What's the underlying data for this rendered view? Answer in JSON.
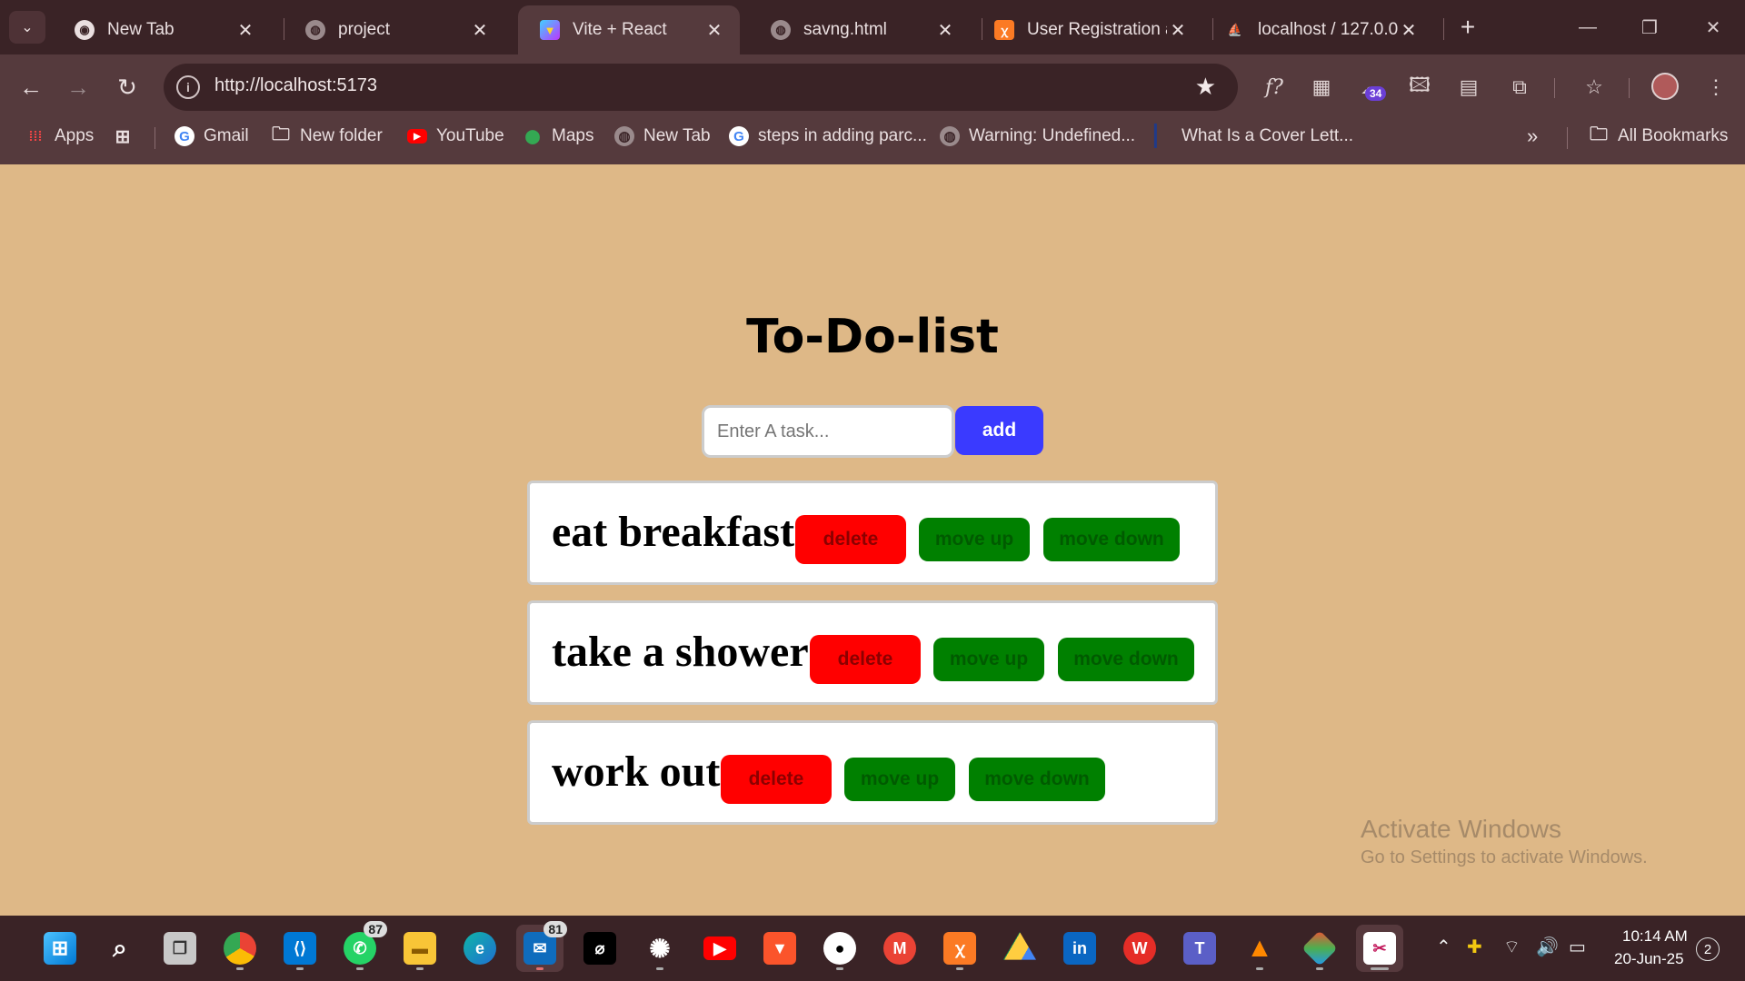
{
  "browser": {
    "tabs": [
      {
        "title": "New Tab",
        "icon": "chrome-icon",
        "active": false
      },
      {
        "title": "project",
        "icon": "globe-icon",
        "active": false
      },
      {
        "title": "Vite + React",
        "icon": "vite-icon",
        "active": true
      },
      {
        "title": "savng.html",
        "icon": "globe-icon",
        "active": false
      },
      {
        "title": "User Registration a",
        "icon": "xampp-icon",
        "active": false
      },
      {
        "title": "localhost / 127.0.0.",
        "icon": "phpmyadmin-icon",
        "active": false
      }
    ],
    "url": "http://localhost:5173",
    "extension_badge": "34",
    "bookmarks": [
      {
        "label": "Apps",
        "icon": "apps-grid-icon"
      },
      {
        "label": "",
        "icon": "grid-icon"
      },
      {
        "label": "Gmail",
        "icon": "google-icon"
      },
      {
        "label": "New folder",
        "icon": "folder-icon"
      },
      {
        "label": "YouTube",
        "icon": "youtube-icon"
      },
      {
        "label": "Maps",
        "icon": "maps-icon"
      },
      {
        "label": "New Tab",
        "icon": "globe-icon"
      },
      {
        "label": "steps in adding parc...",
        "icon": "google-icon"
      },
      {
        "label": "Warning: Undefined...",
        "icon": "globe-icon"
      },
      {
        "label": "What Is a Cover Lett...",
        "icon": "bookmark-icon"
      }
    ],
    "more_bookmarks": "»",
    "all_bookmarks": "All Bookmarks"
  },
  "app": {
    "heading": "To-Do-list",
    "input": {
      "placeholder": "Enter A task...",
      "value": ""
    },
    "add_label": "add",
    "tasks": [
      {
        "text": "eat breakfast"
      },
      {
        "text": "take a shower"
      },
      {
        "text": "work out"
      }
    ],
    "delete_label": "delete",
    "move_up_label": "move up",
    "move_down_label": "move down"
  },
  "watermark": {
    "line1": "Activate Windows",
    "line2": "Go to Settings to activate Windows."
  },
  "taskbar": {
    "whatsapp_badge": "87",
    "outlook_badge": "81",
    "time": "10:14 AM",
    "date": "20-Jun-25",
    "notifications": "2"
  },
  "colors": {
    "page_bg": "#deb887",
    "add_button": "#3a3aff",
    "delete_button": "#ff0000",
    "move_button": "#008000",
    "chrome_bg": "#553a3d"
  }
}
